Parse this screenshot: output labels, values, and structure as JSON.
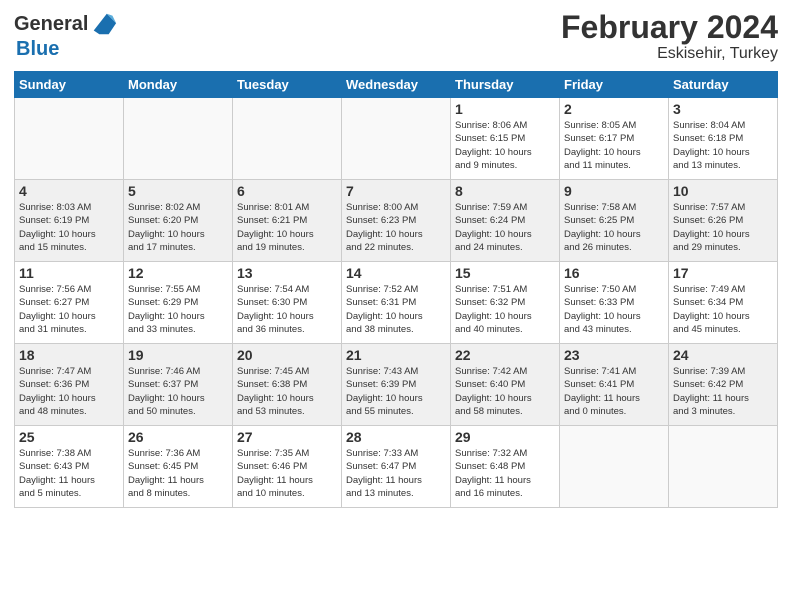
{
  "header": {
    "logo_general": "General",
    "logo_blue": "Blue",
    "month_year": "February 2024",
    "location": "Eskisehir, Turkey"
  },
  "days_of_week": [
    "Sunday",
    "Monday",
    "Tuesday",
    "Wednesday",
    "Thursday",
    "Friday",
    "Saturday"
  ],
  "weeks": [
    [
      {
        "day": "",
        "info": ""
      },
      {
        "day": "",
        "info": ""
      },
      {
        "day": "",
        "info": ""
      },
      {
        "day": "",
        "info": ""
      },
      {
        "day": "1",
        "info": "Sunrise: 8:06 AM\nSunset: 6:15 PM\nDaylight: 10 hours\nand 9 minutes."
      },
      {
        "day": "2",
        "info": "Sunrise: 8:05 AM\nSunset: 6:17 PM\nDaylight: 10 hours\nand 11 minutes."
      },
      {
        "day": "3",
        "info": "Sunrise: 8:04 AM\nSunset: 6:18 PM\nDaylight: 10 hours\nand 13 minutes."
      }
    ],
    [
      {
        "day": "4",
        "info": "Sunrise: 8:03 AM\nSunset: 6:19 PM\nDaylight: 10 hours\nand 15 minutes."
      },
      {
        "day": "5",
        "info": "Sunrise: 8:02 AM\nSunset: 6:20 PM\nDaylight: 10 hours\nand 17 minutes."
      },
      {
        "day": "6",
        "info": "Sunrise: 8:01 AM\nSunset: 6:21 PM\nDaylight: 10 hours\nand 19 minutes."
      },
      {
        "day": "7",
        "info": "Sunrise: 8:00 AM\nSunset: 6:23 PM\nDaylight: 10 hours\nand 22 minutes."
      },
      {
        "day": "8",
        "info": "Sunrise: 7:59 AM\nSunset: 6:24 PM\nDaylight: 10 hours\nand 24 minutes."
      },
      {
        "day": "9",
        "info": "Sunrise: 7:58 AM\nSunset: 6:25 PM\nDaylight: 10 hours\nand 26 minutes."
      },
      {
        "day": "10",
        "info": "Sunrise: 7:57 AM\nSunset: 6:26 PM\nDaylight: 10 hours\nand 29 minutes."
      }
    ],
    [
      {
        "day": "11",
        "info": "Sunrise: 7:56 AM\nSunset: 6:27 PM\nDaylight: 10 hours\nand 31 minutes."
      },
      {
        "day": "12",
        "info": "Sunrise: 7:55 AM\nSunset: 6:29 PM\nDaylight: 10 hours\nand 33 minutes."
      },
      {
        "day": "13",
        "info": "Sunrise: 7:54 AM\nSunset: 6:30 PM\nDaylight: 10 hours\nand 36 minutes."
      },
      {
        "day": "14",
        "info": "Sunrise: 7:52 AM\nSunset: 6:31 PM\nDaylight: 10 hours\nand 38 minutes."
      },
      {
        "day": "15",
        "info": "Sunrise: 7:51 AM\nSunset: 6:32 PM\nDaylight: 10 hours\nand 40 minutes."
      },
      {
        "day": "16",
        "info": "Sunrise: 7:50 AM\nSunset: 6:33 PM\nDaylight: 10 hours\nand 43 minutes."
      },
      {
        "day": "17",
        "info": "Sunrise: 7:49 AM\nSunset: 6:34 PM\nDaylight: 10 hours\nand 45 minutes."
      }
    ],
    [
      {
        "day": "18",
        "info": "Sunrise: 7:47 AM\nSunset: 6:36 PM\nDaylight: 10 hours\nand 48 minutes."
      },
      {
        "day": "19",
        "info": "Sunrise: 7:46 AM\nSunset: 6:37 PM\nDaylight: 10 hours\nand 50 minutes."
      },
      {
        "day": "20",
        "info": "Sunrise: 7:45 AM\nSunset: 6:38 PM\nDaylight: 10 hours\nand 53 minutes."
      },
      {
        "day": "21",
        "info": "Sunrise: 7:43 AM\nSunset: 6:39 PM\nDaylight: 10 hours\nand 55 minutes."
      },
      {
        "day": "22",
        "info": "Sunrise: 7:42 AM\nSunset: 6:40 PM\nDaylight: 10 hours\nand 58 minutes."
      },
      {
        "day": "23",
        "info": "Sunrise: 7:41 AM\nSunset: 6:41 PM\nDaylight: 11 hours\nand 0 minutes."
      },
      {
        "day": "24",
        "info": "Sunrise: 7:39 AM\nSunset: 6:42 PM\nDaylight: 11 hours\nand 3 minutes."
      }
    ],
    [
      {
        "day": "25",
        "info": "Sunrise: 7:38 AM\nSunset: 6:43 PM\nDaylight: 11 hours\nand 5 minutes."
      },
      {
        "day": "26",
        "info": "Sunrise: 7:36 AM\nSunset: 6:45 PM\nDaylight: 11 hours\nand 8 minutes."
      },
      {
        "day": "27",
        "info": "Sunrise: 7:35 AM\nSunset: 6:46 PM\nDaylight: 11 hours\nand 10 minutes."
      },
      {
        "day": "28",
        "info": "Sunrise: 7:33 AM\nSunset: 6:47 PM\nDaylight: 11 hours\nand 13 minutes."
      },
      {
        "day": "29",
        "info": "Sunrise: 7:32 AM\nSunset: 6:48 PM\nDaylight: 11 hours\nand 16 minutes."
      },
      {
        "day": "",
        "info": ""
      },
      {
        "day": "",
        "info": ""
      }
    ]
  ]
}
